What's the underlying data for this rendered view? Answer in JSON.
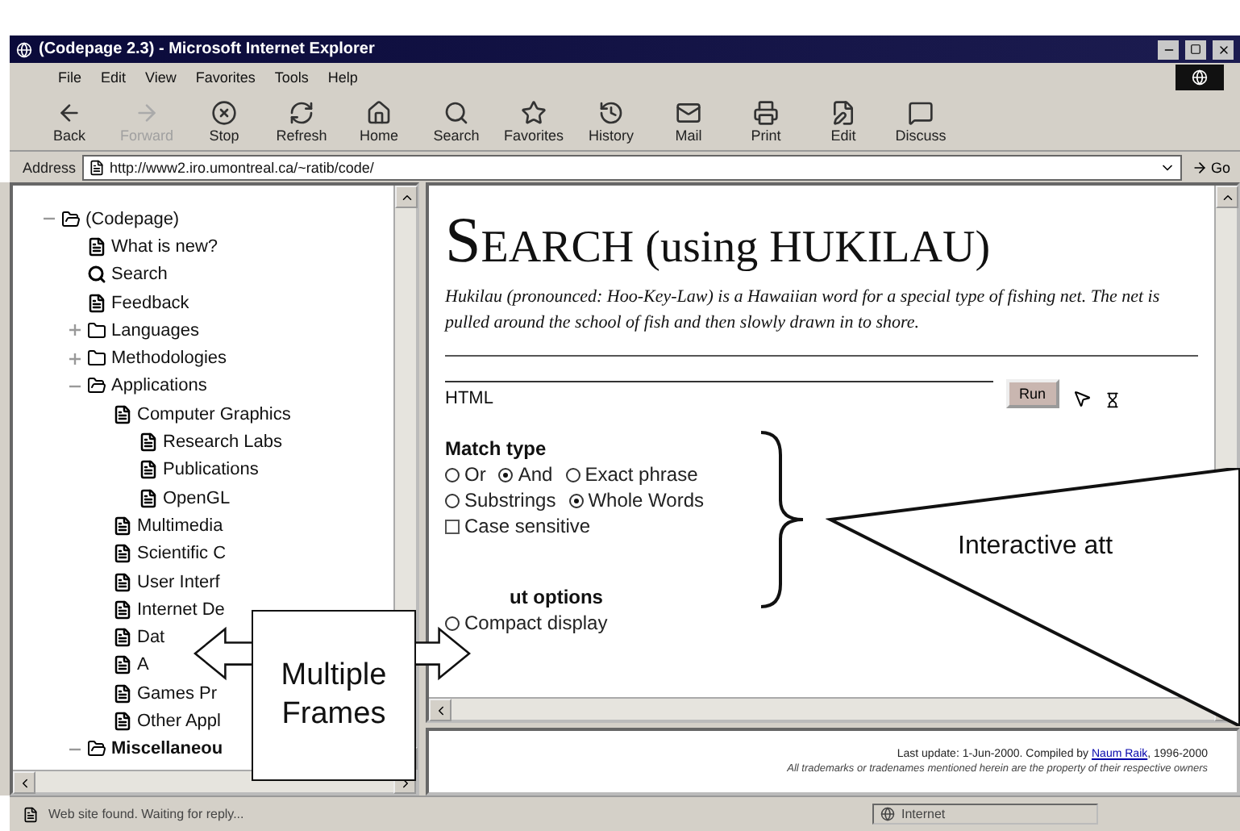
{
  "window": {
    "title": "(Codepage 2.3) - Microsoft Internet Explorer"
  },
  "menu": [
    "File",
    "Edit",
    "View",
    "Favorites",
    "Tools",
    "Help"
  ],
  "toolbar": [
    {
      "label": "Back",
      "kind": "back",
      "disabled": false
    },
    {
      "label": "Forward",
      "kind": "forward",
      "disabled": true
    },
    {
      "label": "Stop",
      "kind": "stop",
      "disabled": false
    },
    {
      "label": "Refresh",
      "kind": "refresh",
      "disabled": false
    },
    {
      "label": "Home",
      "kind": "home",
      "disabled": false
    },
    {
      "label": "Search",
      "kind": "search",
      "disabled": false
    },
    {
      "label": "Favorites",
      "kind": "favorites",
      "disabled": false
    },
    {
      "label": "History",
      "kind": "history",
      "disabled": false
    },
    {
      "label": "Mail",
      "kind": "mail",
      "disabled": false
    },
    {
      "label": "Print",
      "kind": "print",
      "disabled": false
    },
    {
      "label": "Edit",
      "kind": "edit",
      "disabled": false
    },
    {
      "label": "Discuss",
      "kind": "discuss",
      "disabled": false
    }
  ],
  "address": {
    "label": "Address",
    "value": "http://www2.iro.umontreal.ca/~ratib/code/",
    "go": "Go"
  },
  "tree": [
    {
      "label": "(Codepage)",
      "kind": "folder",
      "expanded": true,
      "children": [
        {
          "label": "What is new?",
          "kind": "page"
        },
        {
          "label": "Search",
          "kind": "search"
        },
        {
          "label": "Feedback",
          "kind": "page"
        },
        {
          "label": "Languages",
          "kind": "folder",
          "expanded": false
        },
        {
          "label": "Methodologies",
          "kind": "folder",
          "expanded": false
        },
        {
          "label": "Applications",
          "kind": "folder",
          "expanded": true,
          "children": [
            {
              "label": "Computer Graphics",
              "kind": "page",
              "children": [
                {
                  "label": "Research Labs",
                  "kind": "page"
                },
                {
                  "label": "Publications",
                  "kind": "page"
                },
                {
                  "label": "OpenGL",
                  "kind": "page"
                }
              ]
            },
            {
              "label": "Multimedia",
              "kind": "page"
            },
            {
              "label": "Scientific C",
              "kind": "page"
            },
            {
              "label": "User Interf",
              "kind": "page"
            },
            {
              "label": "Internet De",
              "kind": "page"
            },
            {
              "label": "Dat",
              "kind": "page"
            },
            {
              "label": "A",
              "kind": "page"
            },
            {
              "label": "Games Pr",
              "kind": "page"
            },
            {
              "label": "Other Appl",
              "kind": "page"
            }
          ]
        },
        {
          "label": "Miscellaneou",
          "kind": "folder",
          "expanded": true,
          "bold": true
        }
      ]
    }
  ],
  "content": {
    "title_initial": "S",
    "title_rest": "EARCH",
    "title_suffix": "(using HUKILAU)",
    "intro": "Hukilau (pronounced: Hoo-Key-Law) is a Hawaiian word for a special type of fishing net. The net is pulled around the school of fish and then slowly drawn in to shore.",
    "query": "HTML",
    "run": "Run",
    "match_heading": "Match type",
    "match_radios": [
      {
        "label": "Or",
        "selected": false
      },
      {
        "label": "And",
        "selected": true
      },
      {
        "label": "Exact phrase",
        "selected": false
      }
    ],
    "word_radios": [
      {
        "label": "Substrings",
        "selected": false
      },
      {
        "label": "Whole Words",
        "selected": true
      }
    ],
    "case": {
      "label": "Case sensitive",
      "checked": false
    },
    "output_heading": "ut options",
    "output_option": "Compact display"
  },
  "footer": {
    "update": "Last update: 1-Jun-2000.  Compiled by",
    "author": "Naum Raik",
    "years": ", 1996-2000",
    "notice": "All trademarks or tradenames mentioned herein are the property of their respective owners"
  },
  "status": {
    "text": "Web site found. Waiting for reply...",
    "zone": "Internet"
  },
  "callouts": {
    "frames": "Multiple Frames",
    "interactive": "Interactive att"
  }
}
